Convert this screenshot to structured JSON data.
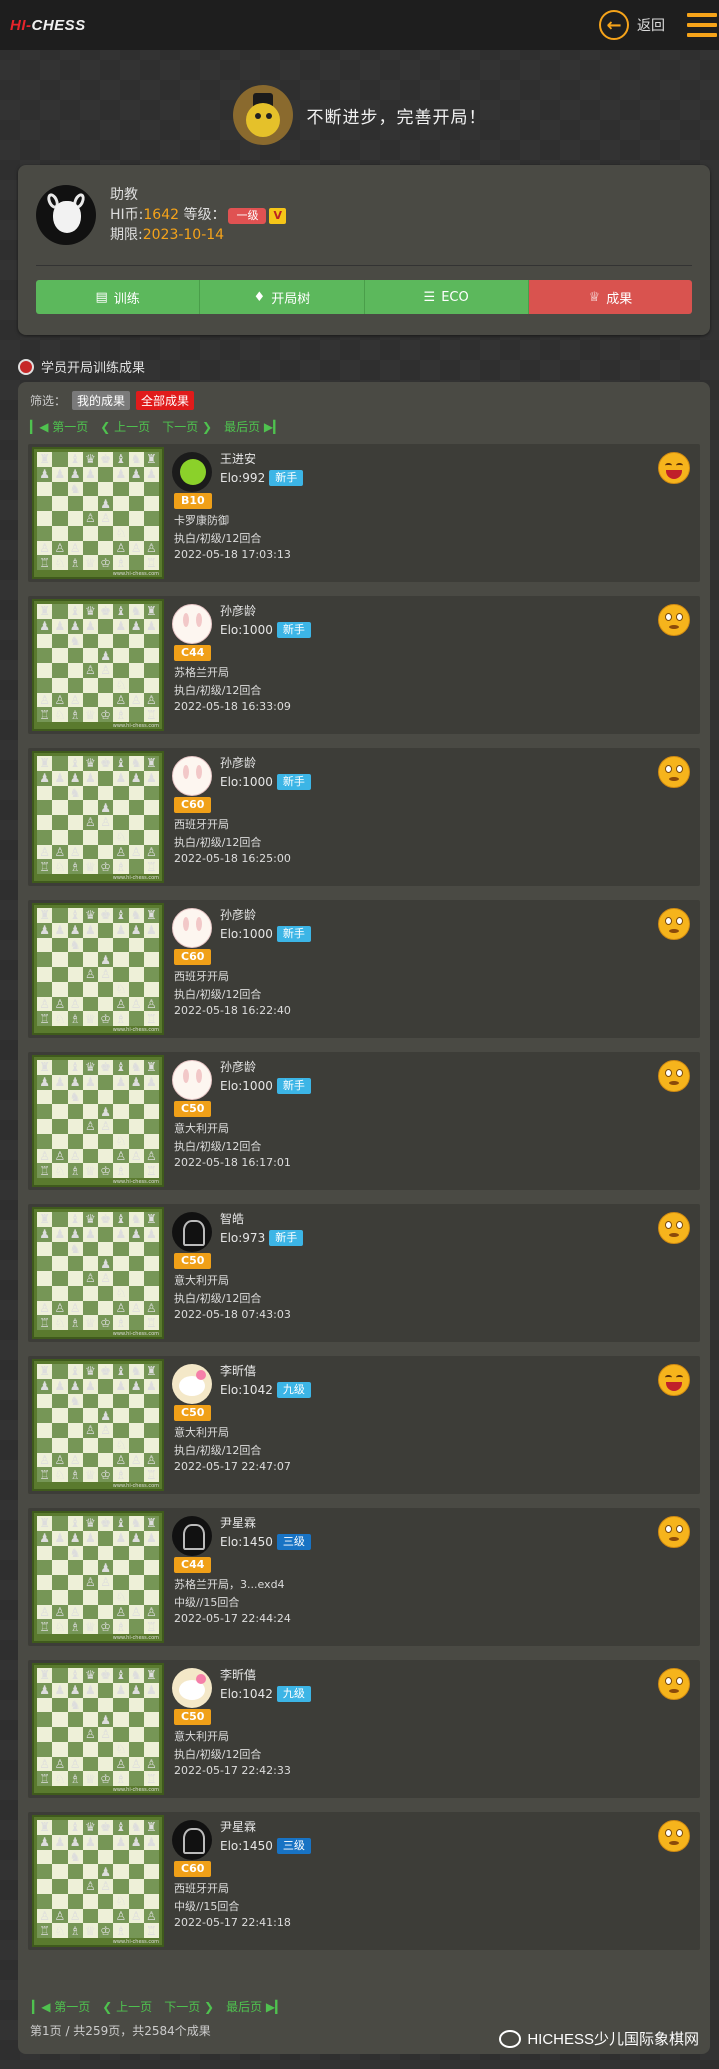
{
  "header": {
    "logo_hi": "HI-",
    "logo_chess": "CHESS",
    "back_label": "返回"
  },
  "slogan": "不断进步，完善开局！",
  "profile": {
    "role": "助教",
    "hi_coin_label": "HI币:",
    "hi_coin": "1642",
    "level_label": "等级：",
    "level": "一级",
    "vip": "V",
    "expiry_label": "期限:",
    "expiry": "2023-10-14"
  },
  "tabs": [
    {
      "label": "训练",
      "icon": "book-icon"
    },
    {
      "label": "开局树",
      "icon": "bell-icon"
    },
    {
      "label": "ECO",
      "icon": "list-icon"
    },
    {
      "label": "成果",
      "icon": "crown-icon"
    }
  ],
  "section_title": "学员开局训练成果",
  "filter": {
    "label": "筛选：",
    "mine": "我的成果",
    "all": "全部成果"
  },
  "pager": {
    "first": "第一页",
    "prev": "上一页",
    "next": "下一页",
    "last": "最后页"
  },
  "items": [
    {
      "name": "王进安",
      "elo": "Elo:992",
      "level": "新手",
      "level_color": "cyan",
      "eco": "B10",
      "opening": "卡罗康防御",
      "mode": "执白/初级/12回合",
      "time": "2022-05-18 17:03:13",
      "avatar": "green",
      "emoji": "laugh"
    },
    {
      "name": "孙彦龄",
      "elo": "Elo:1000",
      "level": "新手",
      "level_color": "cyan",
      "eco": "C44",
      "opening": "苏格兰开局",
      "mode": "执白/初级/12回合",
      "time": "2022-05-18 16:33:09",
      "avatar": "bunny",
      "emoji": "sad"
    },
    {
      "name": "孙彦龄",
      "elo": "Elo:1000",
      "level": "新手",
      "level_color": "cyan",
      "eco": "C60",
      "opening": "西班牙开局",
      "mode": "执白/初级/12回合",
      "time": "2022-05-18 16:25:00",
      "avatar": "bunny",
      "emoji": "sad"
    },
    {
      "name": "孙彦龄",
      "elo": "Elo:1000",
      "level": "新手",
      "level_color": "cyan",
      "eco": "C60",
      "opening": "西班牙开局",
      "mode": "执白/初级/12回合",
      "time": "2022-05-18 16:22:40",
      "avatar": "bunny",
      "emoji": "sad"
    },
    {
      "name": "孙彦龄",
      "elo": "Elo:1000",
      "level": "新手",
      "level_color": "cyan",
      "eco": "C50",
      "opening": "意大利开局",
      "mode": "执白/初级/12回合",
      "time": "2022-05-18 16:17:01",
      "avatar": "bunny",
      "emoji": "sad"
    },
    {
      "name": "智皓",
      "elo": "Elo:973",
      "level": "新手",
      "level_color": "cyan",
      "eco": "C50",
      "opening": "意大利开局",
      "mode": "执白/初级/12回合",
      "time": "2022-05-18 07:43:03",
      "avatar": "dark",
      "emoji": "sad"
    },
    {
      "name": "李昕僖",
      "elo": "Elo:1042",
      "level": "九级",
      "level_color": "cyan",
      "eco": "C50",
      "opening": "意大利开局",
      "mode": "执白/初级/12回合",
      "time": "2022-05-17 22:47:07",
      "avatar": "kitty",
      "emoji": "laugh"
    },
    {
      "name": "尹星霖",
      "elo": "Elo:1450",
      "level": "三级",
      "level_color": "blue",
      "eco": "C44",
      "opening": "苏格兰开局，3...exd4",
      "mode": "中级//15回合",
      "time": "2022-05-17 22:44:24",
      "avatar": "dark",
      "emoji": "sad"
    },
    {
      "name": "李昕僖",
      "elo": "Elo:1042",
      "level": "九级",
      "level_color": "cyan",
      "eco": "C50",
      "opening": "意大利开局",
      "mode": "执白/初级/12回合",
      "time": "2022-05-17 22:42:33",
      "avatar": "kitty",
      "emoji": "sad"
    },
    {
      "name": "尹星霖",
      "elo": "Elo:1450",
      "level": "三级",
      "level_color": "blue",
      "eco": "C60",
      "opening": "西班牙开局",
      "mode": "中级//15回合",
      "time": "2022-05-17 22:41:18",
      "avatar": "dark",
      "emoji": "sad"
    }
  ],
  "board_caption": "www.hi-chess.com",
  "footer": "第1页 / 共259页，共2584个成果",
  "watermark": "HICHESS少儿国际象棋网"
}
